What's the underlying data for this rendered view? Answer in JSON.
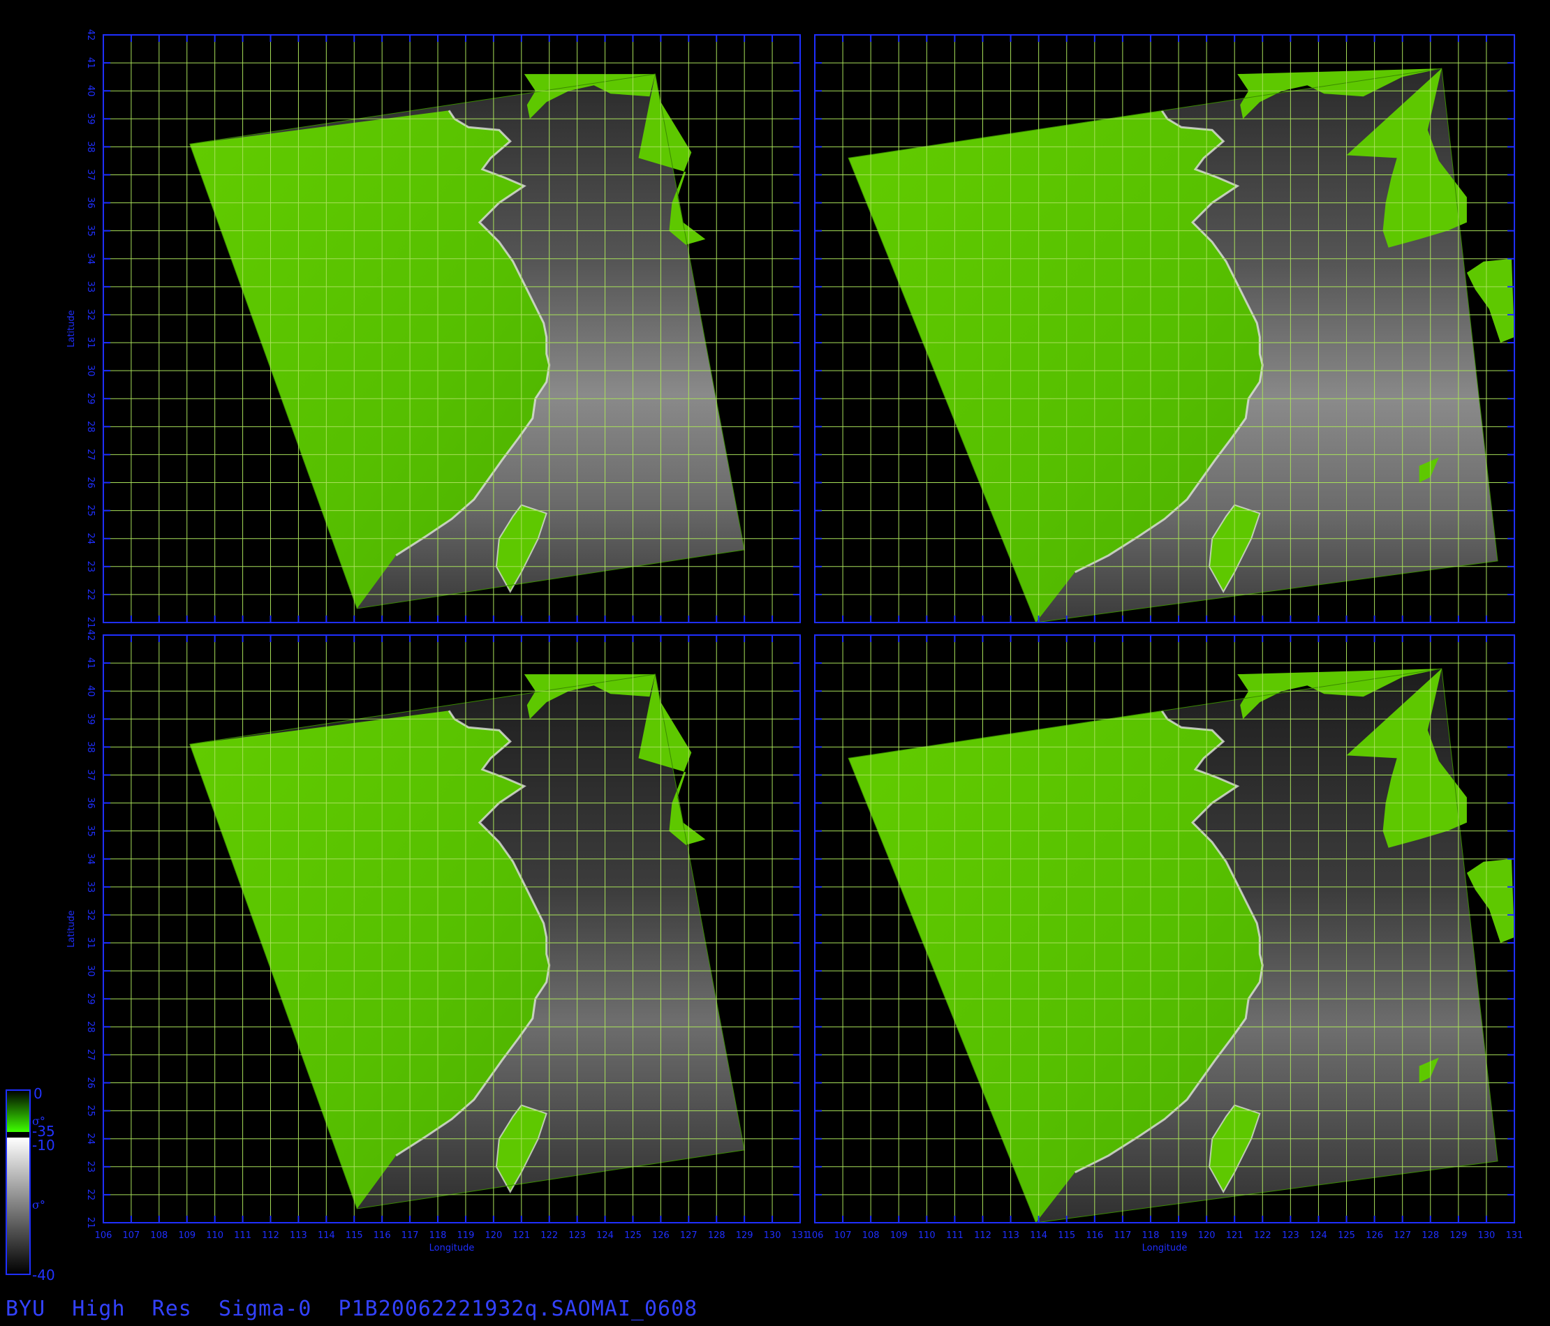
{
  "figure": {
    "title": "BYU  High  Res  Sigma-0  P1B20062221932q.SAOMAI_0608"
  },
  "colors": {
    "background": "#000000",
    "frame": "#1f2fff",
    "grid": "#a8e05a",
    "land": "#5ec800",
    "land_dark": "#3f9a00",
    "tick_text": "#1f2fff"
  },
  "colorbar": {
    "green_range": {
      "top_label": "0",
      "bottom_label": "-35",
      "symbol": "σ°"
    },
    "gray_range": {
      "top_label": "-10",
      "bottom_label": "-40",
      "symbol": "σ°"
    },
    "green_top_color": "#000000",
    "green_bottom_color": "#3fff00",
    "gray_top_color": "#ffffff",
    "gray_bottom_color": "#000000"
  },
  "axes": {
    "x_label": "Longitude",
    "y_label": "Latitude",
    "lon_range": [
      106,
      131
    ],
    "lat_range": [
      21,
      42
    ],
    "lon_ticks": [
      "106",
      "107",
      "108",
      "109",
      "110",
      "111",
      "112",
      "113",
      "114",
      "115",
      "116",
      "117",
      "118",
      "119",
      "120",
      "121",
      "122",
      "123",
      "124",
      "125",
      "126",
      "127",
      "128",
      "129",
      "130",
      "131"
    ],
    "lat_ticks": [
      "21",
      "22",
      "23",
      "24",
      "25",
      "26",
      "27",
      "28",
      "29",
      "30",
      "31",
      "32",
      "33",
      "34",
      "35",
      "36",
      "37",
      "38",
      "39",
      "40",
      "41",
      "42"
    ],
    "top_left_lat_corner_label": "42",
    "bottom_left_lat_corner_label": "4221",
    "bottom_left_lon_end_label": "13106",
    "grid": true
  },
  "panels": [
    {
      "id": "top-left",
      "swath": "left"
    },
    {
      "id": "top-right",
      "swath": "right"
    },
    {
      "id": "bottom-left",
      "swath": "left"
    },
    {
      "id": "bottom-right",
      "swath": "right"
    }
  ]
}
